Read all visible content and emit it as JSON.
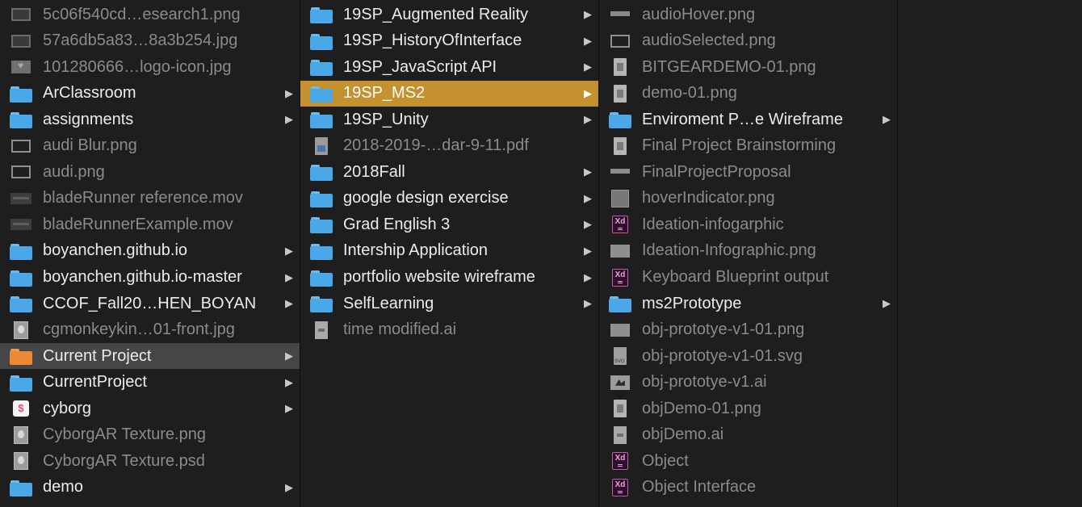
{
  "columns": [
    {
      "items": [
        {
          "name": "5c06f540cd…esearch1.png",
          "kind": "file",
          "icon": "image-thumbnail-icon"
        },
        {
          "name": "57a6db5a83…8a3b254.jpg",
          "kind": "file",
          "icon": "image-thumbnail-icon"
        },
        {
          "name": "101280666…logo-icon.jpg",
          "kind": "file",
          "icon": "logo-thumbnail-icon"
        },
        {
          "name": "ArClassroom",
          "kind": "folder",
          "icon": "folder-icon",
          "arrow": "▶"
        },
        {
          "name": "assignments",
          "kind": "folder",
          "icon": "folder-icon",
          "arrow": "▶"
        },
        {
          "name": "audi Blur.png",
          "kind": "file",
          "icon": "image-thumbnail-icon"
        },
        {
          "name": "audi.png",
          "kind": "file",
          "icon": "image-thumbnail-icon"
        },
        {
          "name": "bladeRunner reference.mov",
          "kind": "file",
          "icon": "video-thumbnail-icon"
        },
        {
          "name": "bladeRunnerExample.mov",
          "kind": "file",
          "icon": "video-thumbnail-icon"
        },
        {
          "name": "boyanchen.github.io",
          "kind": "folder",
          "icon": "folder-icon",
          "arrow": "▶"
        },
        {
          "name": "boyanchen.github.io-master",
          "kind": "folder",
          "icon": "folder-icon",
          "arrow": "▶"
        },
        {
          "name": "CCOF_Fall20…HEN_BOYAN",
          "kind": "folder",
          "icon": "folder-icon",
          "arrow": "▶"
        },
        {
          "name": "cgmonkeykin…01-front.jpg",
          "kind": "file",
          "icon": "photo-thumbnail-icon"
        },
        {
          "name": "Current Project",
          "kind": "folder",
          "icon": "folder-icon",
          "arrow": "▶",
          "selected": "inactive",
          "folder_color": "orange"
        },
        {
          "name": "CurrentProject",
          "kind": "folder",
          "icon": "folder-icon",
          "arrow": "▶"
        },
        {
          "name": "cyborg",
          "kind": "folder",
          "icon": "app-icon",
          "arrow": "▶"
        },
        {
          "name": "CyborgAR Texture.png",
          "kind": "file",
          "icon": "photo-thumbnail-icon"
        },
        {
          "name": "CyborgAR Texture.psd",
          "kind": "file",
          "icon": "photo-thumbnail-icon"
        },
        {
          "name": "demo",
          "kind": "folder",
          "icon": "folder-icon",
          "arrow": "▶"
        }
      ]
    },
    {
      "items": [
        {
          "name": "19SP_Augmented Reality",
          "kind": "folder",
          "icon": "folder-icon",
          "arrow": "▶"
        },
        {
          "name": "19SP_HistoryOfInterface",
          "kind": "folder",
          "icon": "folder-icon",
          "arrow": "▶"
        },
        {
          "name": "19SP_JavaScript API",
          "kind": "folder",
          "icon": "folder-icon",
          "arrow": "▶"
        },
        {
          "name": "19SP_MS2",
          "kind": "folder",
          "icon": "folder-icon",
          "arrow": "▶",
          "selected": "active"
        },
        {
          "name": "19SP_Unity",
          "kind": "folder",
          "icon": "folder-icon",
          "arrow": "▶"
        },
        {
          "name": "2018-2019-…dar-9-11.pdf",
          "kind": "file",
          "icon": "pdf-document-icon"
        },
        {
          "name": "2018Fall",
          "kind": "folder",
          "icon": "folder-icon",
          "arrow": "▶"
        },
        {
          "name": "google design exercise",
          "kind": "folder",
          "icon": "folder-icon",
          "arrow": "▶"
        },
        {
          "name": "Grad English 3",
          "kind": "folder",
          "icon": "folder-icon",
          "arrow": "▶"
        },
        {
          "name": "Intership Application",
          "kind": "folder",
          "icon": "folder-icon",
          "arrow": "▶"
        },
        {
          "name": "portfolio website wireframe",
          "kind": "folder",
          "icon": "folder-icon",
          "arrow": "▶"
        },
        {
          "name": "SelfLearning",
          "kind": "folder",
          "icon": "folder-icon",
          "arrow": "▶"
        },
        {
          "name": "time modified.ai",
          "kind": "file",
          "icon": "illustrator-document-icon"
        }
      ]
    },
    {
      "items": [
        {
          "name": "audioHover.png",
          "kind": "file",
          "icon": "image-thumbnail-icon"
        },
        {
          "name": "audioSelected.png",
          "kind": "file",
          "icon": "image-thumbnail-icon"
        },
        {
          "name": "BITGEARDEMO-01.png",
          "kind": "file",
          "icon": "document-thumbnail-icon"
        },
        {
          "name": "demo-01.png",
          "kind": "file",
          "icon": "document-thumbnail-icon"
        },
        {
          "name": "Enviroment P…e Wireframe",
          "kind": "folder",
          "icon": "folder-icon",
          "arrow": "▶"
        },
        {
          "name": "Final Project Brainstorming",
          "kind": "file",
          "icon": "document-thumbnail-icon"
        },
        {
          "name": "FinalProjectProposal",
          "kind": "file",
          "icon": "image-thumbnail-icon"
        },
        {
          "name": "hoverIndicator.png",
          "kind": "file",
          "icon": "image-thumbnail-icon"
        },
        {
          "name": "Ideation-infogarphic",
          "kind": "file",
          "icon": "xd-document-icon"
        },
        {
          "name": "Ideation-Infographic.png",
          "kind": "file",
          "icon": "image-thumbnail-icon"
        },
        {
          "name": "Keyboard Blueprint output",
          "kind": "file",
          "icon": "xd-document-icon"
        },
        {
          "name": "ms2Prototype",
          "kind": "folder",
          "icon": "folder-icon",
          "arrow": "▶"
        },
        {
          "name": "obj-prototye-v1-01.png",
          "kind": "file",
          "icon": "image-thumbnail-icon"
        },
        {
          "name": "obj-prototye-v1-01.svg",
          "kind": "file",
          "icon": "svg-document-icon"
        },
        {
          "name": "obj-prototye-v1.ai",
          "kind": "file",
          "icon": "illustrator-document-icon"
        },
        {
          "name": "objDemo-01.png",
          "kind": "file",
          "icon": "document-thumbnail-icon"
        },
        {
          "name": "objDemo.ai",
          "kind": "file",
          "icon": "illustrator-document-icon"
        },
        {
          "name": "Object",
          "kind": "file",
          "icon": "xd-document-icon"
        },
        {
          "name": "Object Interface",
          "kind": "file",
          "icon": "xd-document-icon"
        }
      ]
    },
    {
      "items": []
    }
  ],
  "colors": {
    "background": "#1e1e1f",
    "selection_active": "#c5902e",
    "selection_inactive": "#464648",
    "folder_blue": "#4aa8e8",
    "folder_orange": "#ec8a33",
    "folder_text": "#ececec",
    "file_text": "#8b8b8d"
  }
}
